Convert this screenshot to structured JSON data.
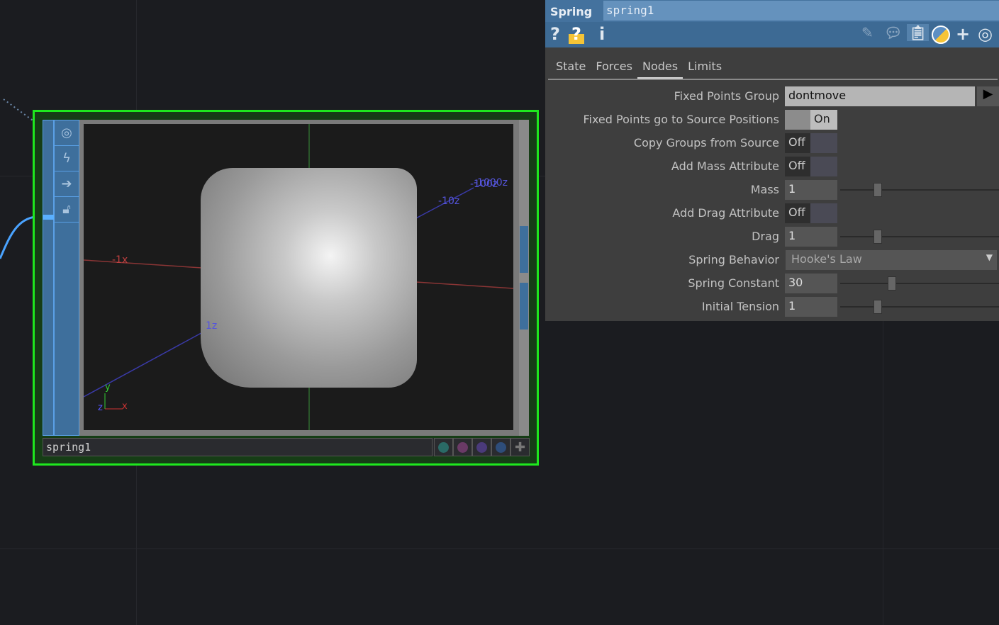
{
  "node": {
    "name": "spring1",
    "border_color": "#1ee81e",
    "tools": [
      "viewer-icon",
      "bypass-icon",
      "display-icon",
      "lock-icon"
    ],
    "footer_dots": [
      "#2a6a66",
      "#6a3a66",
      "#4a3a7a",
      "#2e4d7a"
    ],
    "viewport": {
      "labels": {
        "neg_x": "-1x",
        "pos_z": "1z",
        "neg10z": "-10z",
        "neg100z": "-100z",
        "neg1000z": "-1000z",
        "gy": "y",
        "gz": "z",
        "gx": "x"
      }
    }
  },
  "panel": {
    "type": "Spring",
    "name": "spring1",
    "tabs": [
      {
        "label": "State"
      },
      {
        "label": "Forces"
      },
      {
        "label": "Nodes",
        "active": true
      },
      {
        "label": "Limits"
      }
    ],
    "params": [
      {
        "label": "Fixed Points Group",
        "kind": "string",
        "value": "dontmove"
      },
      {
        "label": "Fixed Points go to Source Positions",
        "kind": "toggle",
        "value": "On"
      },
      {
        "label": "Copy Groups from Source",
        "kind": "toggle",
        "value": "Off"
      },
      {
        "label": "Add Mass Attribute",
        "kind": "toggle",
        "value": "Off"
      },
      {
        "label": "Mass",
        "kind": "number",
        "value": "1",
        "slider": 0.21
      },
      {
        "label": "Add Drag Attribute",
        "kind": "toggle",
        "value": "Off"
      },
      {
        "label": "Drag",
        "kind": "number",
        "value": "1",
        "slider": 0.21
      },
      {
        "label": "Spring Behavior",
        "kind": "menu",
        "value": "Hooke's Law"
      },
      {
        "label": "Spring Constant",
        "kind": "number",
        "value": "30",
        "slider": 0.3
      },
      {
        "label": "Initial Tension",
        "kind": "number",
        "value": "1",
        "slider": 0.21
      }
    ]
  }
}
